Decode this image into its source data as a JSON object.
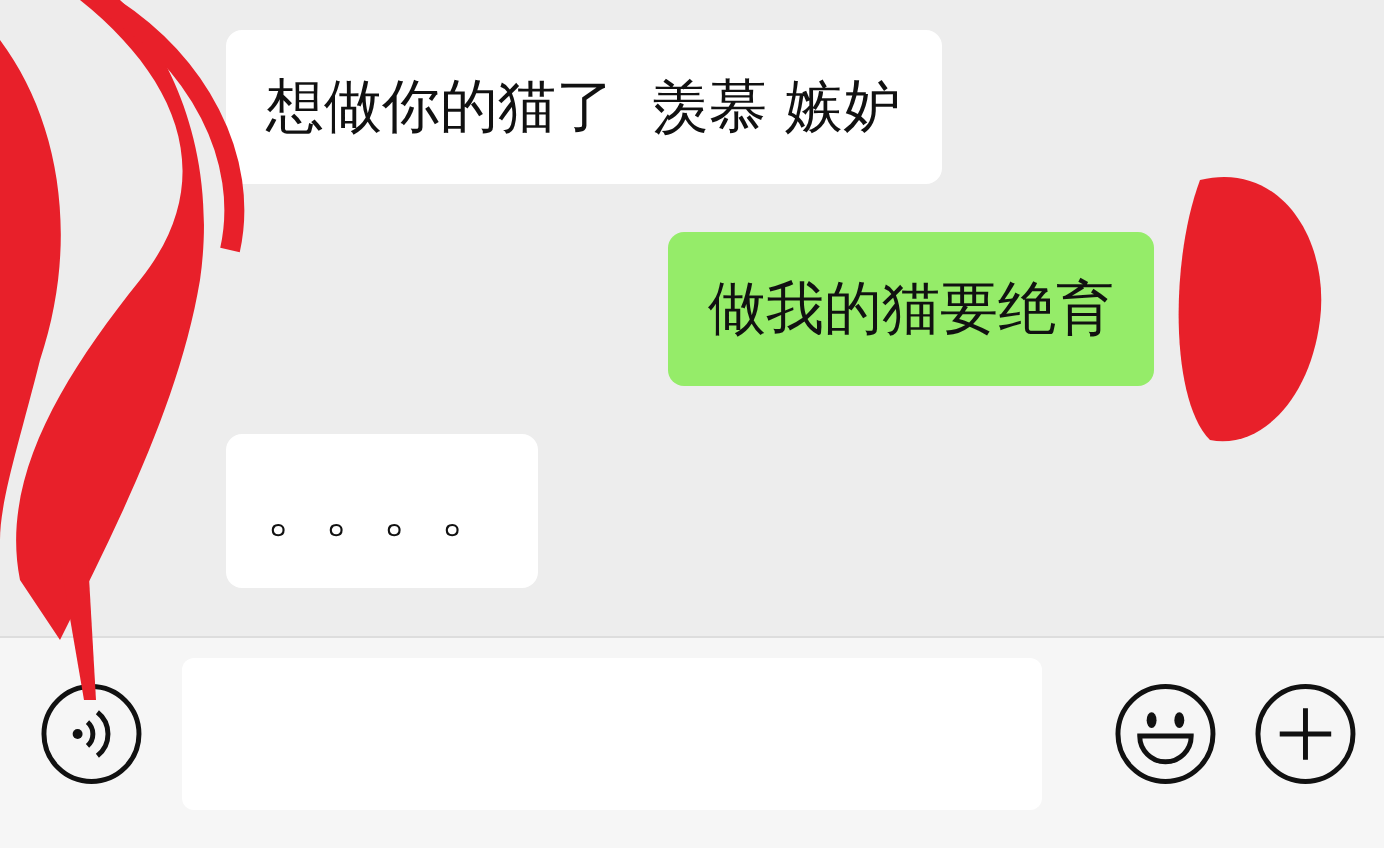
{
  "messages": [
    {
      "kind": "received",
      "text": "想做你的猫了  羡慕 嫉妒"
    },
    {
      "kind": "sent",
      "text": "做我的猫要绝育"
    },
    {
      "kind": "received",
      "text": "。。。。"
    }
  ]
}
